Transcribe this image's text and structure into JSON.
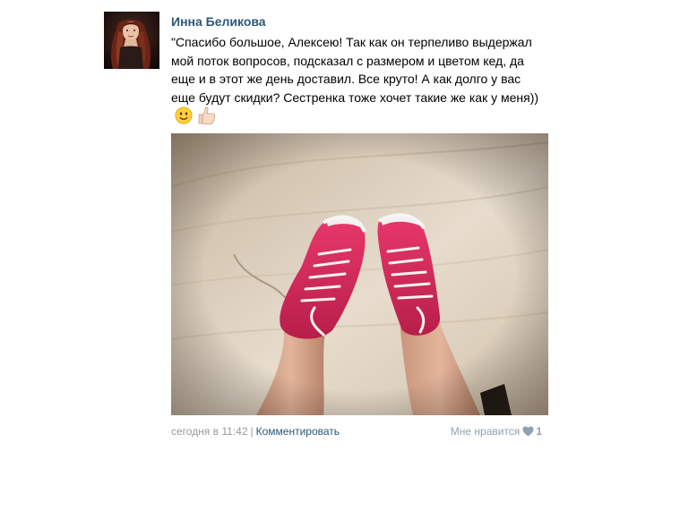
{
  "post": {
    "author": "Инна Беликова",
    "text": "\"Спасибо большое, Алексею! Так как он терпеливо выдержал мой поток вопросов, подсказал с размером и цветом кед, да еще и в этот же день доставил. Все круто! А как долго у вас еще будут скидки? Сестренка тоже хочет такие же как у меня))",
    "emojis": [
      "smiling-face-emoji",
      "thumbs-up-emoji"
    ],
    "photo": {
      "subject": "pink-sneakers-photo"
    },
    "footer": {
      "date": "сегодня в 11:42",
      "separator": "|",
      "comment_label": "Комментировать",
      "like_label": "Мне нравится",
      "like_count": "1"
    }
  },
  "colors": {
    "link": "#2b587a",
    "muted": "#999999",
    "like": "#8fa1b4"
  }
}
